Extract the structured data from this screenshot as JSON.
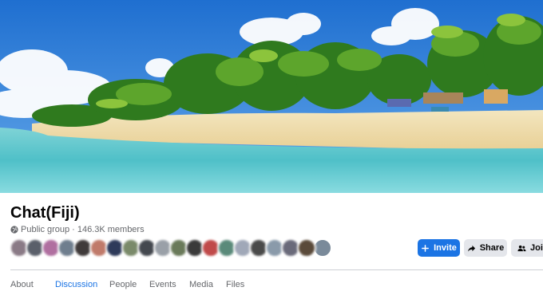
{
  "group": {
    "name": "Chat(Fiji)",
    "privacy": "Public group",
    "separator": "·",
    "members": "146.3K members"
  },
  "actions": {
    "invite_label": "Invite",
    "share_label": "Share",
    "join_label": "Join"
  },
  "tabs": [
    {
      "label": "About",
      "active": false
    },
    {
      "label": "Discussion",
      "active": true
    },
    {
      "label": "People",
      "active": false
    },
    {
      "label": "Events",
      "active": false
    },
    {
      "label": "Media",
      "active": false
    },
    {
      "label": "Files",
      "active": false
    }
  ],
  "member_avatars": [
    {
      "color": "#8a7a86"
    },
    {
      "color": "#5a5f6a"
    },
    {
      "color": "#b06fa0"
    },
    {
      "color": "#6f7e8e"
    },
    {
      "color": "#3f3a3a"
    },
    {
      "color": "#c07a6a"
    },
    {
      "color": "#2e3a5a"
    },
    {
      "color": "#7a8a6a"
    },
    {
      "color": "#44484f"
    },
    {
      "color": "#9aa0a8"
    },
    {
      "color": "#6a7a5a"
    },
    {
      "color": "#3a3a3a"
    },
    {
      "color": "#c04a4a"
    },
    {
      "color": "#5a8a7a"
    },
    {
      "color": "#a0a8b8"
    },
    {
      "color": "#4a4a4a"
    },
    {
      "color": "#8a9aaa"
    },
    {
      "color": "#6a6a7a"
    },
    {
      "color": "#5a4a3a"
    },
    {
      "color": "#7a8a9a"
    }
  ],
  "colors": {
    "accent": "#1b74e4",
    "secondary_button": "#e4e6eb",
    "muted_text": "#65676b"
  },
  "icons": {
    "privacy": "globe-icon",
    "invite": "plus-icon",
    "share": "share-arrow-icon",
    "join": "people-icon"
  }
}
